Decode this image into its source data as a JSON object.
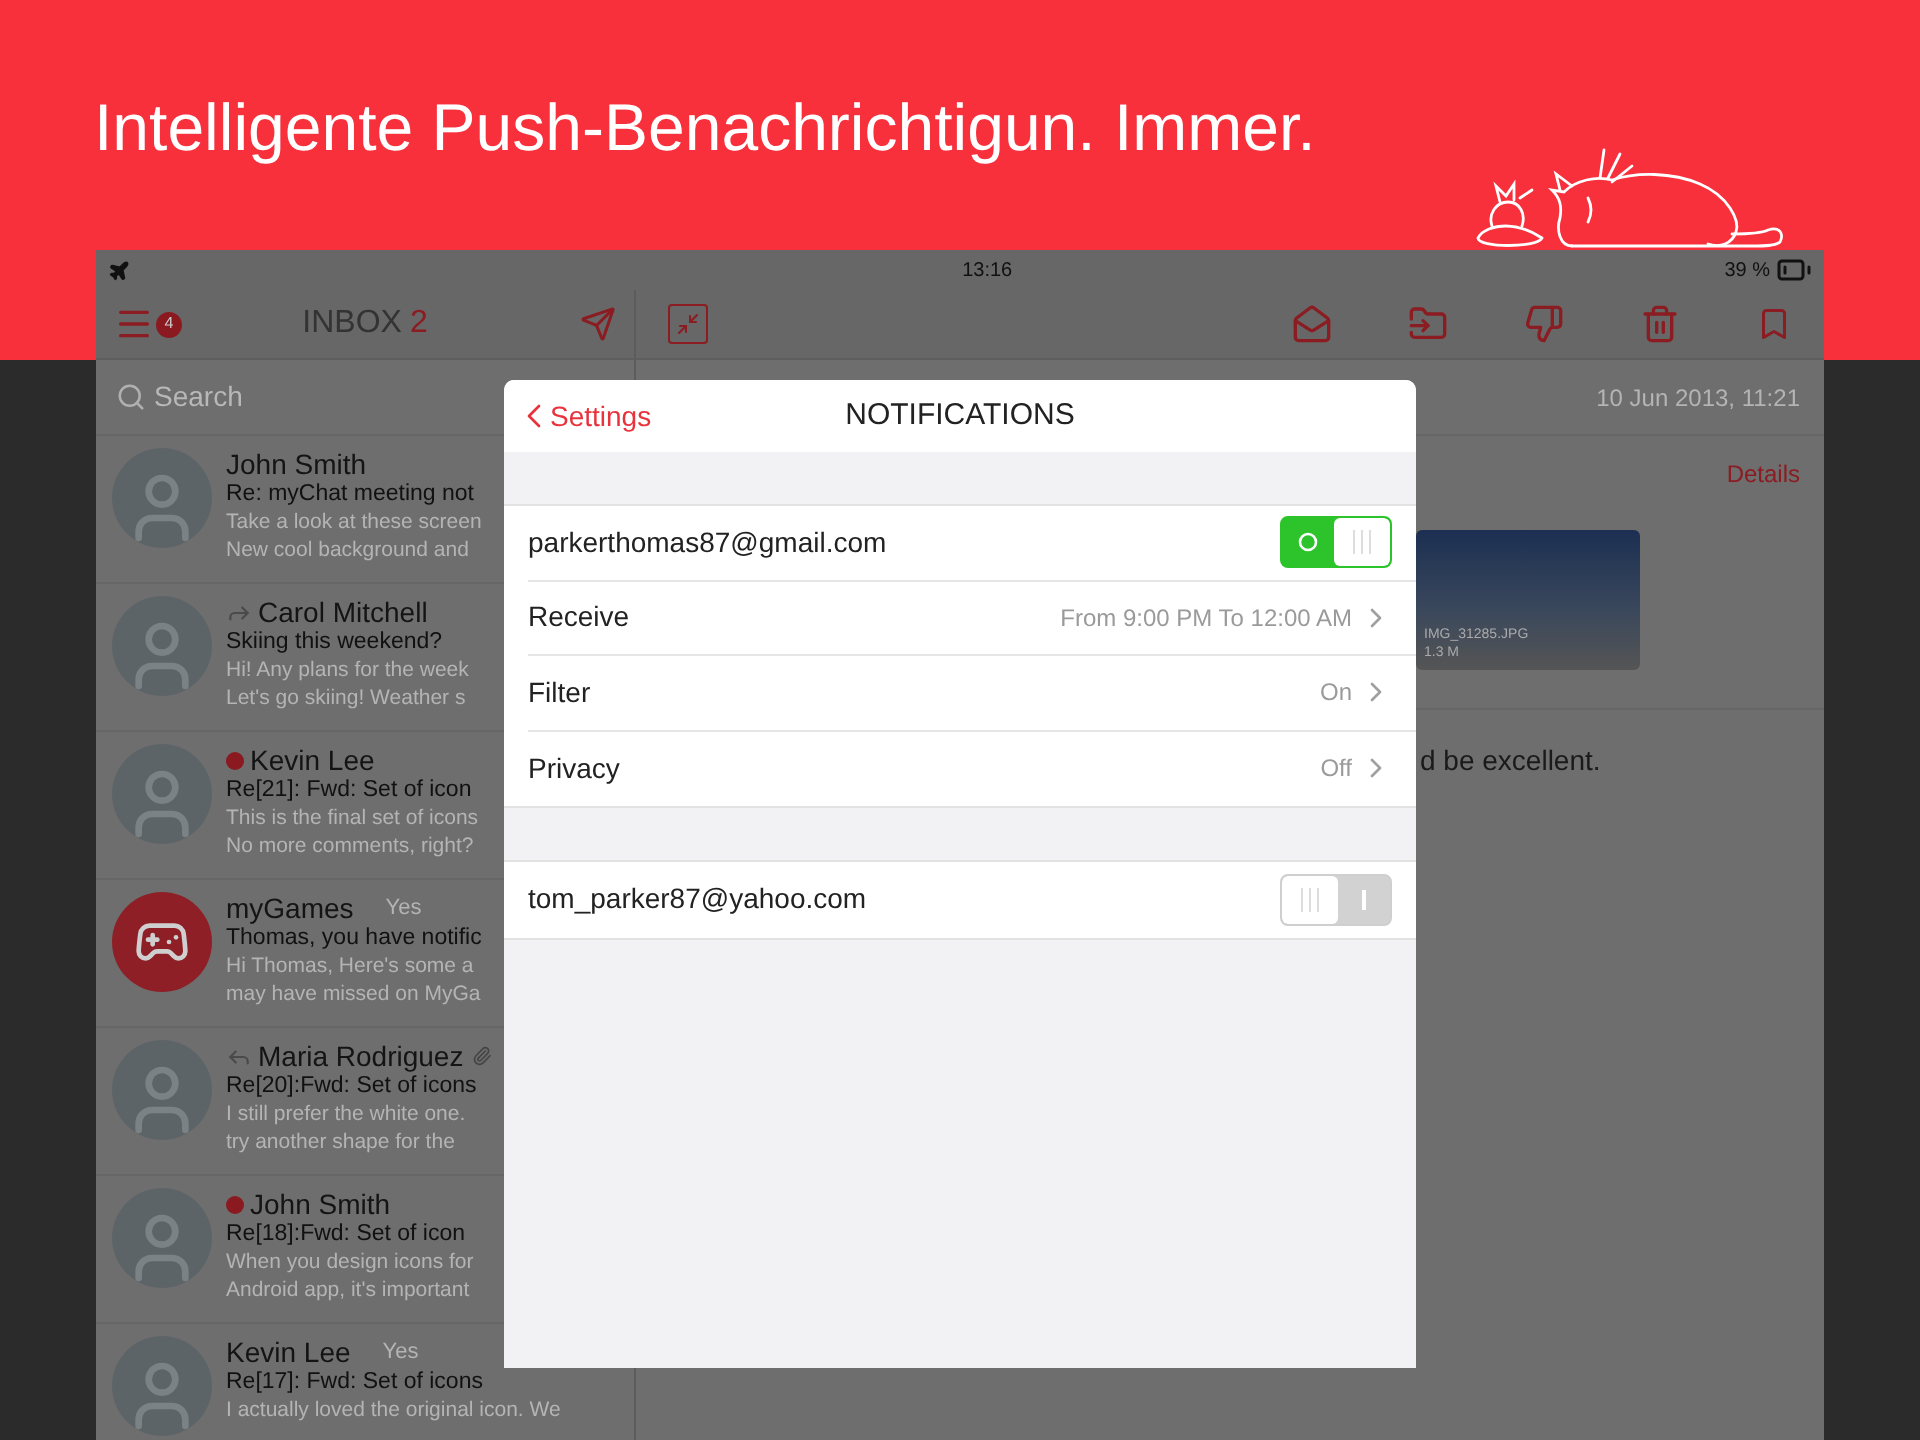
{
  "headline": "Intelligente Push-Benachrichtigun. **Immer.**",
  "status_bar": {
    "time": "13:16",
    "battery": "39 %"
  },
  "inbox": {
    "badge": "4",
    "title": "INBOX",
    "count": "2",
    "search": {
      "placeholder": "Search"
    },
    "messages": [
      {
        "kind": "contact",
        "unread": false,
        "forwarded": false,
        "replied": false,
        "attachment": false,
        "sender": "John Smith",
        "subject": "Re: myChat meeting not",
        "preview": [
          "Take a look at these screen",
          "New cool background and"
        ]
      },
      {
        "kind": "contact",
        "unread": false,
        "forwarded": true,
        "replied": false,
        "attachment": false,
        "sender": "Carol Mitchell",
        "subject": "Skiing this weekend?",
        "preview": [
          "Hi! Any plans for the week",
          "Let's go skiing! Weather s"
        ]
      },
      {
        "kind": "contact",
        "unread": true,
        "forwarded": false,
        "replied": false,
        "attachment": false,
        "sender": "Kevin Lee",
        "subject": "Re[21]: Fwd: Set of icon",
        "preview": [
          "This is the final set of icons",
          "No more comments, right?"
        ]
      },
      {
        "kind": "app",
        "unread": false,
        "forwarded": false,
        "replied": false,
        "attachment": false,
        "sender": "myGames",
        "date": "Yes",
        "subject": "Thomas, you have notific",
        "preview": [
          "Hi Thomas, Here's some a",
          "may have missed on MyGa"
        ]
      },
      {
        "kind": "contact",
        "unread": false,
        "forwarded": false,
        "replied": true,
        "attachment": true,
        "sender": "Maria Rodriguez",
        "subject": "Re[20]:Fwd:  Set of icons",
        "preview": [
          "I still prefer the white one.",
          "try another shape for the"
        ]
      },
      {
        "kind": "contact",
        "unread": true,
        "forwarded": false,
        "replied": false,
        "attachment": false,
        "sender": "John Smith",
        "subject": "Re[18]:Fwd:  Set of icon",
        "preview": [
          "When you design icons for",
          "Android app, it's important"
        ]
      },
      {
        "kind": "contact",
        "unread": false,
        "forwarded": false,
        "replied": false,
        "attachment": false,
        "sender": "Kevin Lee",
        "date": "Yes",
        "subject": "Re[17]: Fwd: Set of icons",
        "preview": [
          "I actually loved the original icon. We"
        ]
      }
    ]
  },
  "message": {
    "date": "10 Jun 2013, 11:21",
    "details": "Details",
    "attachment": {
      "name": "IMG_31285.JPG",
      "size": "1.3 M"
    },
    "body": "d be excellent."
  },
  "dialog": {
    "back": "Settings",
    "title": "NOTIFICATIONS",
    "sections": [
      [
        {
          "kind": "toggle",
          "label": "parkerthomas87@gmail.com",
          "on": true
        },
        {
          "kind": "link",
          "label": "Receive",
          "value": "From 9:00 PM To 12:00 AM"
        },
        {
          "kind": "link",
          "label": "Filter",
          "value": "On"
        },
        {
          "kind": "link",
          "label": "Privacy",
          "value": "Off"
        }
      ],
      [
        {
          "kind": "toggle",
          "label": "tom_parker87@yahoo.com",
          "on": false
        }
      ]
    ]
  }
}
